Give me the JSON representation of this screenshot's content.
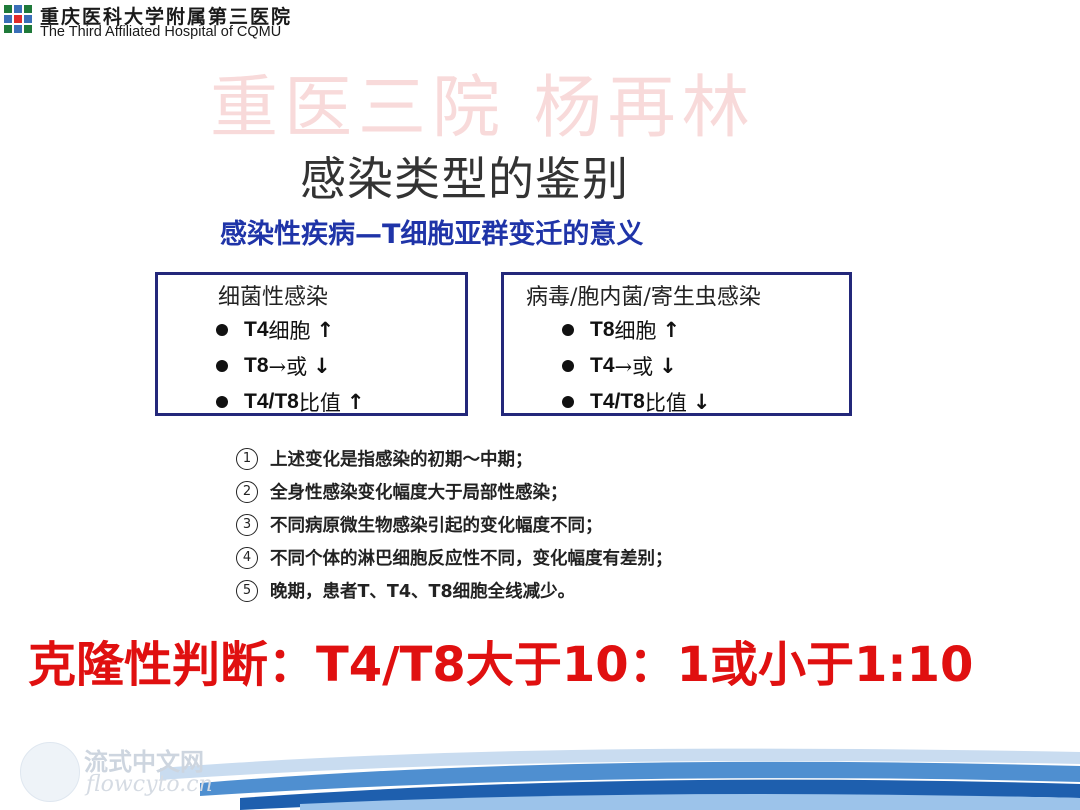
{
  "header": {
    "name_cn": "重庆医科大学附属第三医院",
    "name_en": "The Third Affiliated Hospital of CQMU"
  },
  "watermark": "重医三院 杨再林",
  "title": "感染类型的鉴别",
  "subtitle": "感染性疾病—T细胞亚群变迁的意义",
  "boxes": [
    {
      "header": "细菌性感染",
      "items": [
        {
          "code": "T4",
          "rest": "细胞",
          "arrow": "↑"
        },
        {
          "code": "T8",
          "rest": "→或",
          "arrow": "↓"
        },
        {
          "code": "T4/T8",
          "rest": "比值",
          "arrow": "↑"
        }
      ]
    },
    {
      "header": "病毒/胞内菌/寄生虫感染",
      "items": [
        {
          "code": "T8",
          "rest": "细胞",
          "arrow": "↑"
        },
        {
          "code": "T4",
          "rest": "→或",
          "arrow": "↓"
        },
        {
          "code": "T4/T8",
          "rest": "比值",
          "arrow": "↓"
        }
      ]
    }
  ],
  "notes": [
    {
      "num": "1",
      "text": "上述变化是指感染的初期～中期；"
    },
    {
      "num": "2",
      "text": "全身性感染变化幅度大于局部性感染；"
    },
    {
      "num": "3",
      "text": "不同病原微生物感染引起的变化幅度不同；"
    },
    {
      "num": "4",
      "text": "不同个体的淋巴细胞反应性不同，变化幅度有差别；"
    },
    {
      "num": "5",
      "text": "晚期，患者T、T4、T8细胞全线减少。"
    }
  ],
  "conclusion": "克隆性判断：T4/T8大于10：1或小于1:10",
  "footer": {
    "logo_cn": "流式中文网",
    "logo_en": "flowcyto.cn"
  },
  "colors": {
    "title_blue": "#1f34a8",
    "box_border": "#23287a",
    "conclusion_red": "#e01010",
    "watermark_pink": "#f8dada"
  }
}
